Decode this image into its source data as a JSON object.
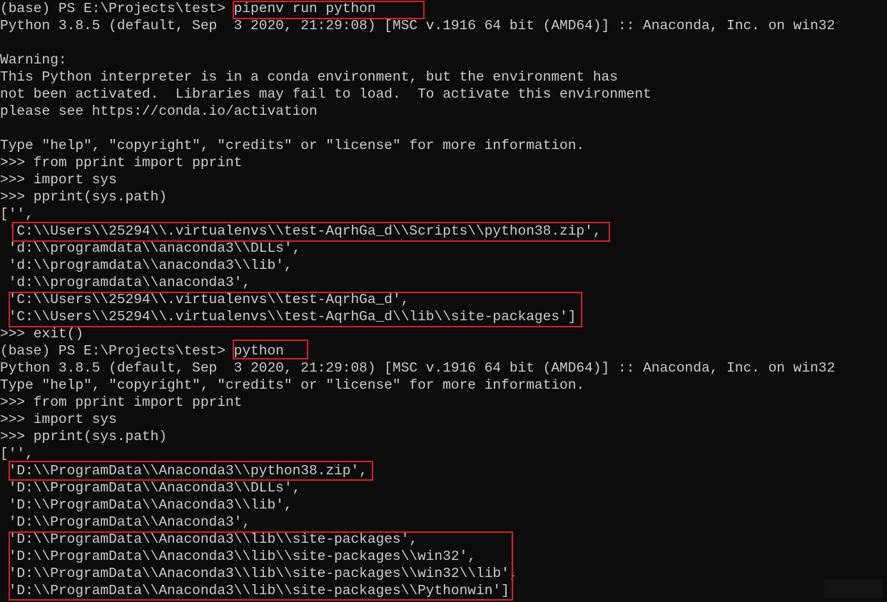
{
  "terminal": {
    "background": "#0c0c0c",
    "foreground": "#cccccc",
    "highlight_color": "#d3202e",
    "lines": [
      "(base) PS E:\\Projects\\test> pipenv run python",
      "Python 3.8.5 (default, Sep  3 2020, 21:29:08) [MSC v.1916 64 bit (AMD64)] :: Anaconda, Inc. on win32",
      "",
      "Warning:",
      "This Python interpreter is in a conda environment, but the environment has",
      "not been activated.  Libraries may fail to load.  To activate this environment",
      "please see https://conda.io/activation",
      "",
      "Type \"help\", \"copyright\", \"credits\" or \"license\" for more information.",
      ">>> from pprint import pprint",
      ">>> import sys",
      ">>> pprint(sys.path)",
      "['',",
      " 'C:\\\\Users\\\\25294\\\\.virtualenvs\\\\test-AqrhGa_d\\\\Scripts\\\\python38.zip',",
      " 'd:\\\\programdata\\\\anaconda3\\\\DLLs',",
      " 'd:\\\\programdata\\\\anaconda3\\\\lib',",
      " 'd:\\\\programdata\\\\anaconda3',",
      " 'C:\\\\Users\\\\25294\\\\.virtualenvs\\\\test-AqrhGa_d',",
      " 'C:\\\\Users\\\\25294\\\\.virtualenvs\\\\test-AqrhGa_d\\\\lib\\\\site-packages']",
      ">>> exit()",
      "(base) PS E:\\Projects\\test> python",
      "Python 3.8.5 (default, Sep  3 2020, 21:29:08) [MSC v.1916 64 bit (AMD64)] :: Anaconda, Inc. on win32",
      "Type \"help\", \"copyright\", \"credits\" or \"license\" for more information.",
      ">>> from pprint import pprint",
      ">>> import sys",
      ">>> pprint(sys.path)",
      "['',",
      " 'D:\\\\ProgramData\\\\Anaconda3\\\\python38.zip',",
      " 'D:\\\\ProgramData\\\\Anaconda3\\\\DLLs',",
      " 'D:\\\\ProgramData\\\\Anaconda3\\\\lib',",
      " 'D:\\\\ProgramData\\\\Anaconda3',",
      " 'D:\\\\ProgramData\\\\Anaconda3\\\\lib\\\\site-packages',",
      " 'D:\\\\ProgramData\\\\Anaconda3\\\\lib\\\\site-packages\\\\win32',",
      " 'D:\\\\ProgramData\\\\Anaconda3\\\\lib\\\\site-packages\\\\win32\\\\lib',",
      " 'D:\\\\ProgramData\\\\Anaconda3\\\\lib\\\\site-packages\\\\Pythonwin']"
    ]
  }
}
